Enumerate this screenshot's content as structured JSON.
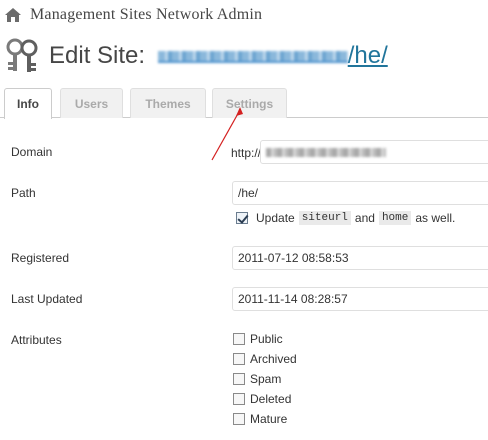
{
  "header": {
    "network_title": "Management Sites Network Admin",
    "edit_prefix": "Edit Site:",
    "site_path": "/he/",
    "house_icon": "house-icon",
    "keys_icon": "keys-icon"
  },
  "tabs": [
    {
      "label": "Info",
      "active": true
    },
    {
      "label": "Users",
      "active": false
    },
    {
      "label": "Themes",
      "active": false
    },
    {
      "label": "Settings",
      "active": false
    }
  ],
  "form": {
    "domain": {
      "label": "Domain",
      "prefix": "http://"
    },
    "path": {
      "label": "Path",
      "value": "/he/"
    },
    "update": {
      "checked": true,
      "text_before": "Update",
      "code1": "siteurl",
      "text_and": "and",
      "code2": "home",
      "text_after": "as well."
    },
    "registered": {
      "label": "Registered",
      "value": "2011-07-12 08:58:53"
    },
    "last_updated": {
      "label": "Last Updated",
      "value": "2011-11-14 08:28:57"
    },
    "attributes": {
      "label": "Attributes",
      "options": [
        {
          "label": "Public",
          "checked": false
        },
        {
          "label": "Archived",
          "checked": false
        },
        {
          "label": "Spam",
          "checked": false
        },
        {
          "label": "Deleted",
          "checked": false
        },
        {
          "label": "Mature",
          "checked": false
        }
      ]
    }
  },
  "colors": {
    "link": "#21759b",
    "annotation_arrow": "#d42020",
    "tab_inactive_text": "#aaaaaa"
  }
}
